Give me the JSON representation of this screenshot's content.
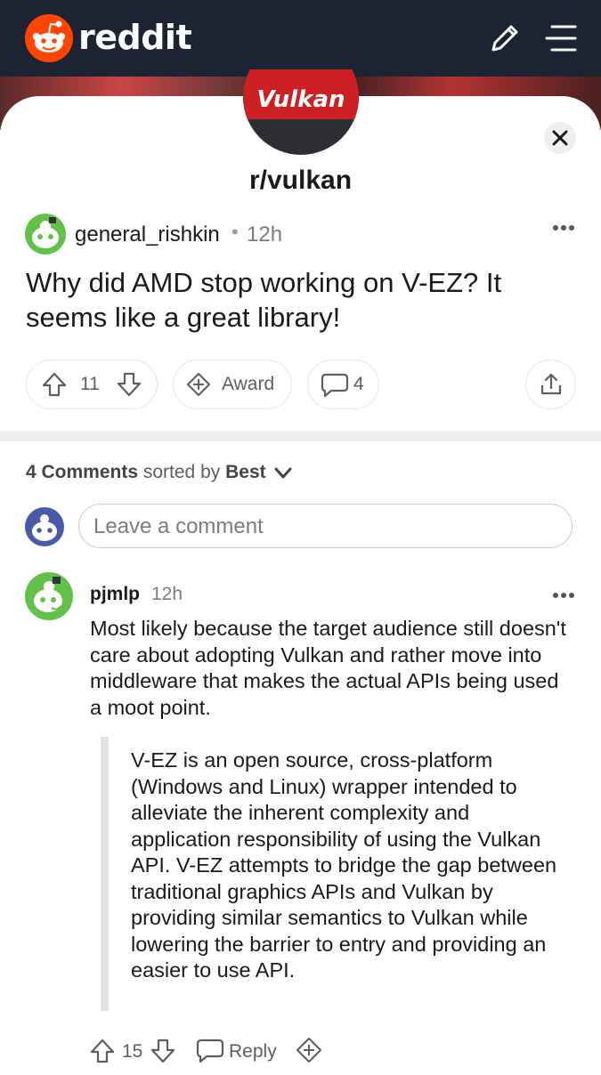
{
  "app": {
    "name": "reddit",
    "accent": "#ff4500",
    "header_bg": "#1c2333"
  },
  "subreddit": {
    "name": "r/vulkan",
    "logo_text": "Vulkan"
  },
  "post": {
    "author": "general_rishkin",
    "time": "12h",
    "title": "Why did AMD stop working on V-EZ? It seems like a great library!",
    "votes": "11",
    "award_label": "Award",
    "comment_count": "4"
  },
  "comments_header": {
    "count_label": "4 Comments",
    "sorted_by": "sorted by",
    "sort": "Best"
  },
  "comment_input": {
    "placeholder": "Leave a comment"
  },
  "comments": [
    {
      "author": "pjmlp",
      "time": "12h",
      "body": "Most likely because the target audience still doesn't care about adopting Vulkan and rather move into middleware that makes the actual APIs being used a moot point.",
      "quote": "V-EZ is an open source, cross-platform (Windows and Linux) wrapper intended to alleviate the inherent complexity and application responsibility of using the Vulkan API. V-EZ attempts to bridge the gap between traditional graphics APIs and Vulkan by providing similar semantics to Vulkan while lowering the barrier to entry and providing an easier to use API.",
      "votes": "15",
      "reply_label": "Reply"
    }
  ]
}
